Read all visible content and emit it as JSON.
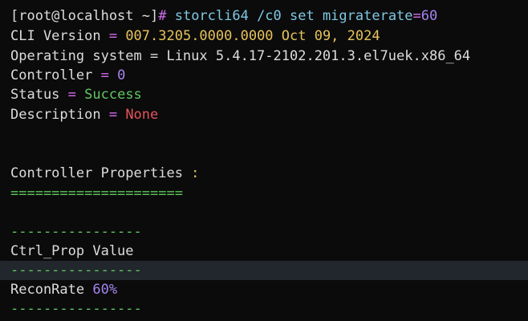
{
  "prompt": {
    "user_host": "[root@localhost ~]",
    "symbol": "#",
    "command": " storcli64 /c0 set migraterate",
    "equals": "=",
    "value": "60"
  },
  "header": {
    "cli_label": "CLI Version ",
    "cli_eq": "= ",
    "cli_version": "007.3205.0000.0000 Oct 09, 2024",
    "os_label": "Operating system = Linux 5.4.17-2102.201.3.el7uek.x86_64",
    "ctrl_label": "Controller ",
    "ctrl_eq": "= ",
    "ctrl_value": "0",
    "status_label": "Status ",
    "status_eq": "= ",
    "status_value": "Success",
    "desc_label": "Description ",
    "desc_eq": "= ",
    "desc_value": "None"
  },
  "section": {
    "title": "Controller Properties ",
    "colon": ":",
    "underline": "====================="
  },
  "table": {
    "rule": "----------------",
    "header": "Ctrl_Prop Value",
    "row_prop": "ReconRate ",
    "row_value": "60%"
  },
  "colors": {
    "background": "#0b0b0b",
    "purple": "#d46bf0",
    "cyan": "#7ec8e3",
    "yellow": "#e6c35c",
    "green": "#5fc85f",
    "red": "#e5535a",
    "highlight_row": "#22262d"
  }
}
